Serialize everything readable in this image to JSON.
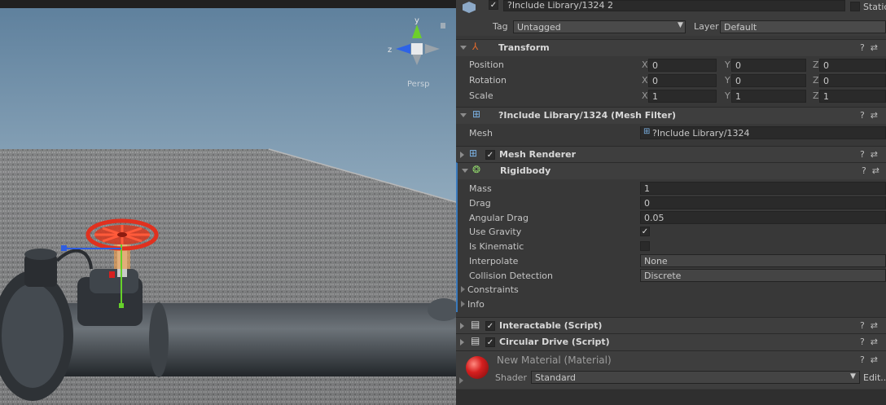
{
  "scene": {
    "persp_label": "Persp",
    "gizmo_labels": {
      "y": "y",
      "z": "z"
    }
  },
  "header": {
    "object_name": "?Include Library/1324 2",
    "static_label": "Static",
    "tag_label": "Tag",
    "tag_value": "Untagged",
    "layer_label": "Layer",
    "layer_value": "Default"
  },
  "transform": {
    "title": "Transform",
    "rows": [
      {
        "label": "Position",
        "x": "0",
        "y": "0",
        "z": "0"
      },
      {
        "label": "Rotation",
        "x": "0",
        "y": "0",
        "z": "0"
      },
      {
        "label": "Scale",
        "x": "1",
        "y": "1",
        "z": "1"
      }
    ],
    "axis": {
      "x": "X",
      "y": "Y",
      "z": "Z"
    }
  },
  "mesh_filter": {
    "title": "?Include Library/1324 (Mesh Filter)",
    "mesh_label": "Mesh",
    "mesh_value": "?Include Library/1324"
  },
  "mesh_renderer": {
    "title": "Mesh Renderer"
  },
  "rigidbody": {
    "title": "Rigidbody",
    "mass_label": "Mass",
    "mass": "1",
    "drag_label": "Drag",
    "drag": "0",
    "angular_drag_label": "Angular Drag",
    "angular_drag": "0.05",
    "use_gravity_label": "Use Gravity",
    "use_gravity_check": "✓",
    "is_kinematic_label": "Is Kinematic",
    "interpolate_label": "Interpolate",
    "interpolate": "None",
    "collision_label": "Collision Detection",
    "collision": "Discrete",
    "constraints_label": "Constraints",
    "info_label": "Info"
  },
  "interactable": {
    "title": "Interactable (Script)"
  },
  "circular_drive": {
    "title": "Circular Drive (Script)"
  },
  "material": {
    "title": "New Material (Material)",
    "shader_label": "Shader",
    "shader_value": "Standard",
    "edit_label": "Edit..."
  },
  "icons": {
    "help": "?",
    "settings": "⇄",
    "check": "✓"
  },
  "colors": {
    "inspector_bg": "#383838",
    "header_bg": "#3e3e3e",
    "field_bg": "#2a2a2a",
    "valve_red": "#e0311f",
    "rigidbody_accent": "#3a79bb"
  }
}
